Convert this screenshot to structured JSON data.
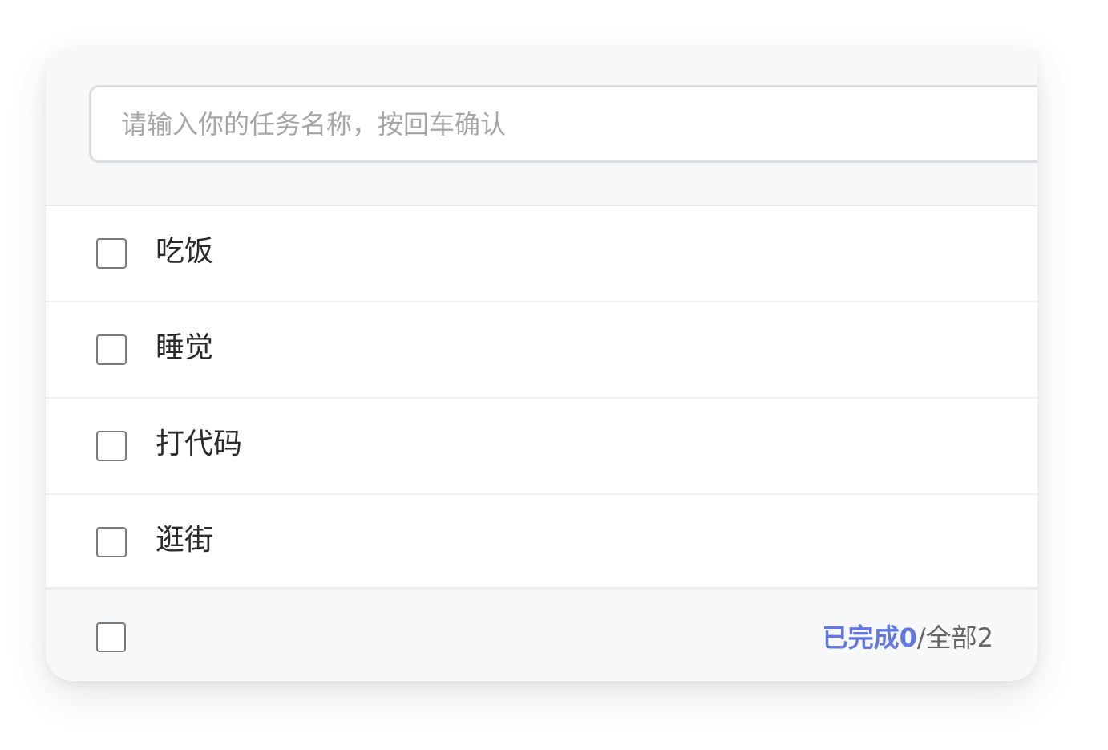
{
  "input": {
    "placeholder": "请输入你的任务名称，按回车确认",
    "value": ""
  },
  "tasks": [
    {
      "label": "吃饭",
      "checked": false
    },
    {
      "label": "睡觉",
      "checked": false
    },
    {
      "label": "打代码",
      "checked": false
    },
    {
      "label": "逛街",
      "checked": false
    }
  ],
  "footer": {
    "completed_label": "已完成",
    "completed_count": "0",
    "separator": "/",
    "total_label": "全部",
    "total_count": "2"
  },
  "colors": {
    "accent": "#6277e2",
    "panel_background": "#f7f8fa"
  }
}
